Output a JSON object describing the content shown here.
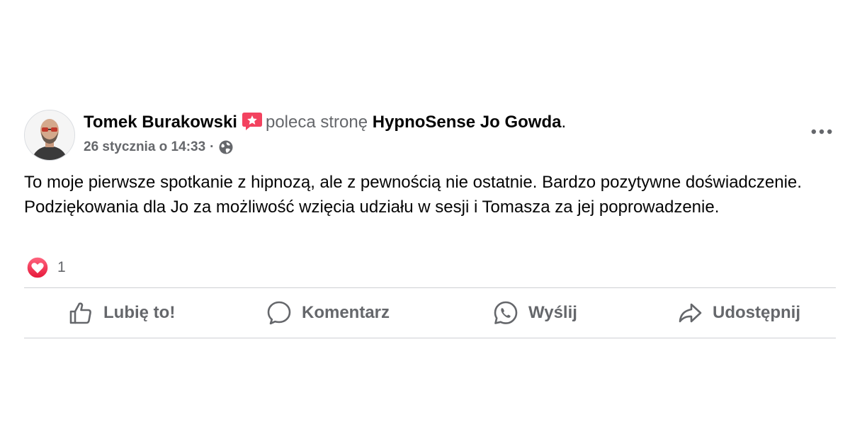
{
  "post": {
    "author": "Tomek Burakowski",
    "recommends_text": "poleca stronę",
    "page_name": "HypnoSense Jo Gowda",
    "page_suffix": ".",
    "timestamp": "26 stycznia o 14:33",
    "separator": "·",
    "privacy_icon": "globe-icon",
    "recommend_icon": "recommend-star-icon",
    "text": "To moje pierwsze spotkanie z hipnozą, ale z pewnością nie ostatnie. Bardzo pozytywne doświadczenie. Podziękowania dla Jo za możliwość wzięcia udziału w sesji i Tomasza za jej poprowadzenie.",
    "reaction_icon": "love-reaction-icon",
    "reaction_count": "1"
  },
  "actions": {
    "like": {
      "label": "Lubię to!",
      "icon": "thumbs-up-icon"
    },
    "comment": {
      "label": "Komentarz",
      "icon": "comment-bubble-icon"
    },
    "send": {
      "label": "Wyślij",
      "icon": "whatsapp-icon"
    },
    "share": {
      "label": "Udostępnij",
      "icon": "share-arrow-icon"
    }
  },
  "colors": {
    "text_primary": "#050505",
    "text_secondary": "#65676b",
    "recommend_badge": "#f3425f",
    "divider": "#ced0d4"
  }
}
